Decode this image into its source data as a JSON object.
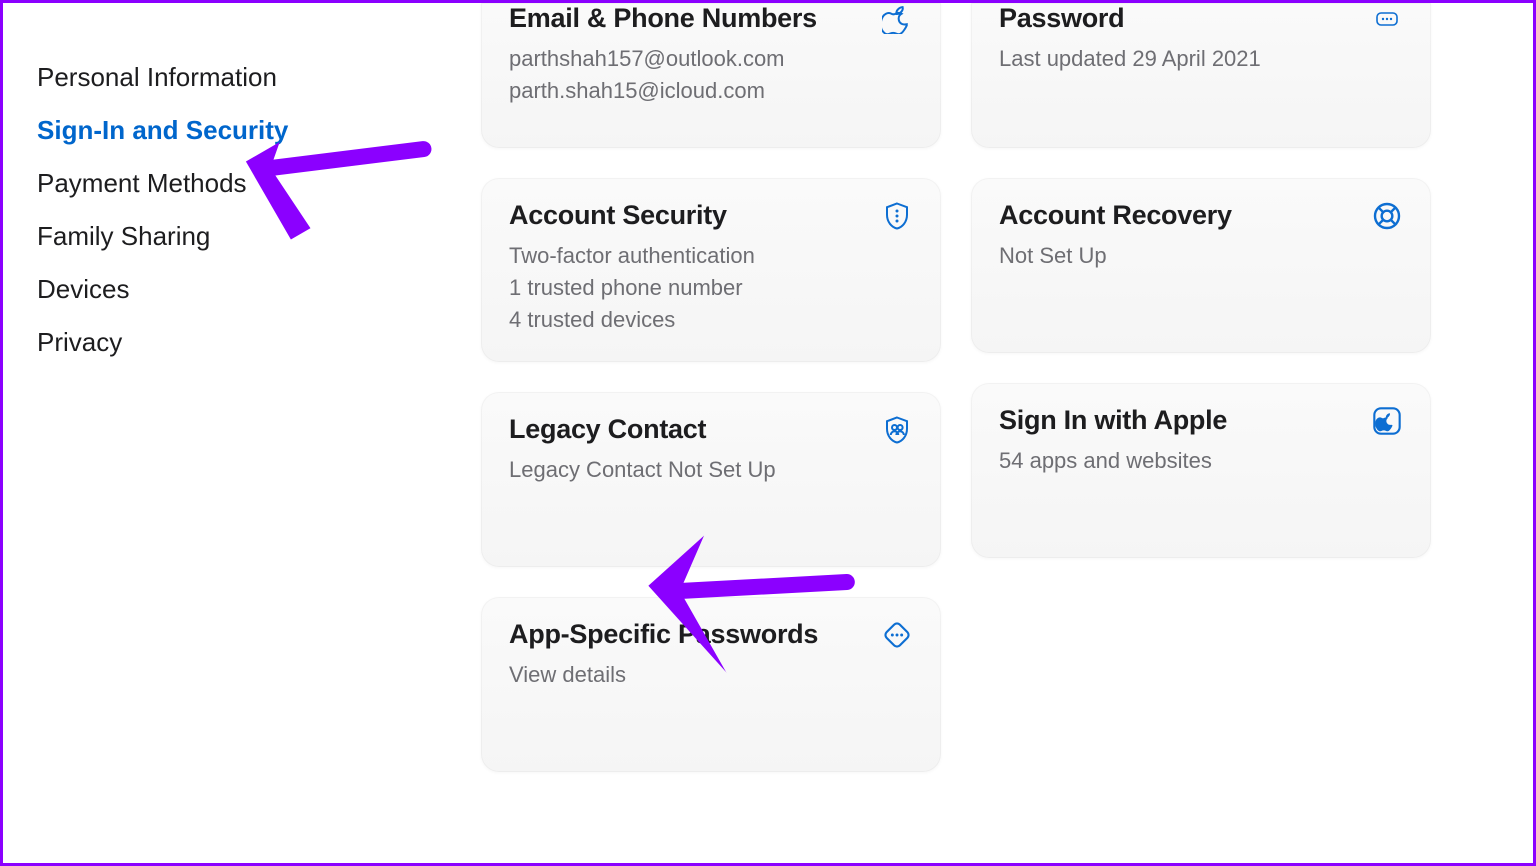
{
  "sidebar": {
    "items": [
      {
        "label": "Personal Information",
        "active": false
      },
      {
        "label": "Sign-In and Security",
        "active": true
      },
      {
        "label": "Payment Methods",
        "active": false
      },
      {
        "label": "Family Sharing",
        "active": false
      },
      {
        "label": "Devices",
        "active": false
      },
      {
        "label": "Privacy",
        "active": false
      }
    ]
  },
  "cards": {
    "email": {
      "title": "Email & Phone Numbers",
      "lines": [
        "parthshah157@outlook.com",
        "parth.shah15@icloud.com"
      ]
    },
    "password": {
      "title": "Password",
      "lines": [
        "Last updated 29 April 2021"
      ]
    },
    "security": {
      "title": "Account Security",
      "lines": [
        "Two-factor authentication",
        "1 trusted phone number",
        "4 trusted devices"
      ]
    },
    "recovery": {
      "title": "Account Recovery",
      "lines": [
        "Not Set Up"
      ]
    },
    "legacy": {
      "title": "Legacy Contact",
      "lines": [
        "Legacy Contact Not Set Up"
      ]
    },
    "siw": {
      "title": "Sign In with Apple",
      "lines": [
        "54 apps and websites"
      ]
    },
    "asp": {
      "title": "App-Specific Passwords",
      "lines": [
        "View details"
      ]
    }
  },
  "colors": {
    "accent": "#0066cc",
    "iconBlue": "#0d6ed2",
    "annotation": "#8b00ff"
  }
}
